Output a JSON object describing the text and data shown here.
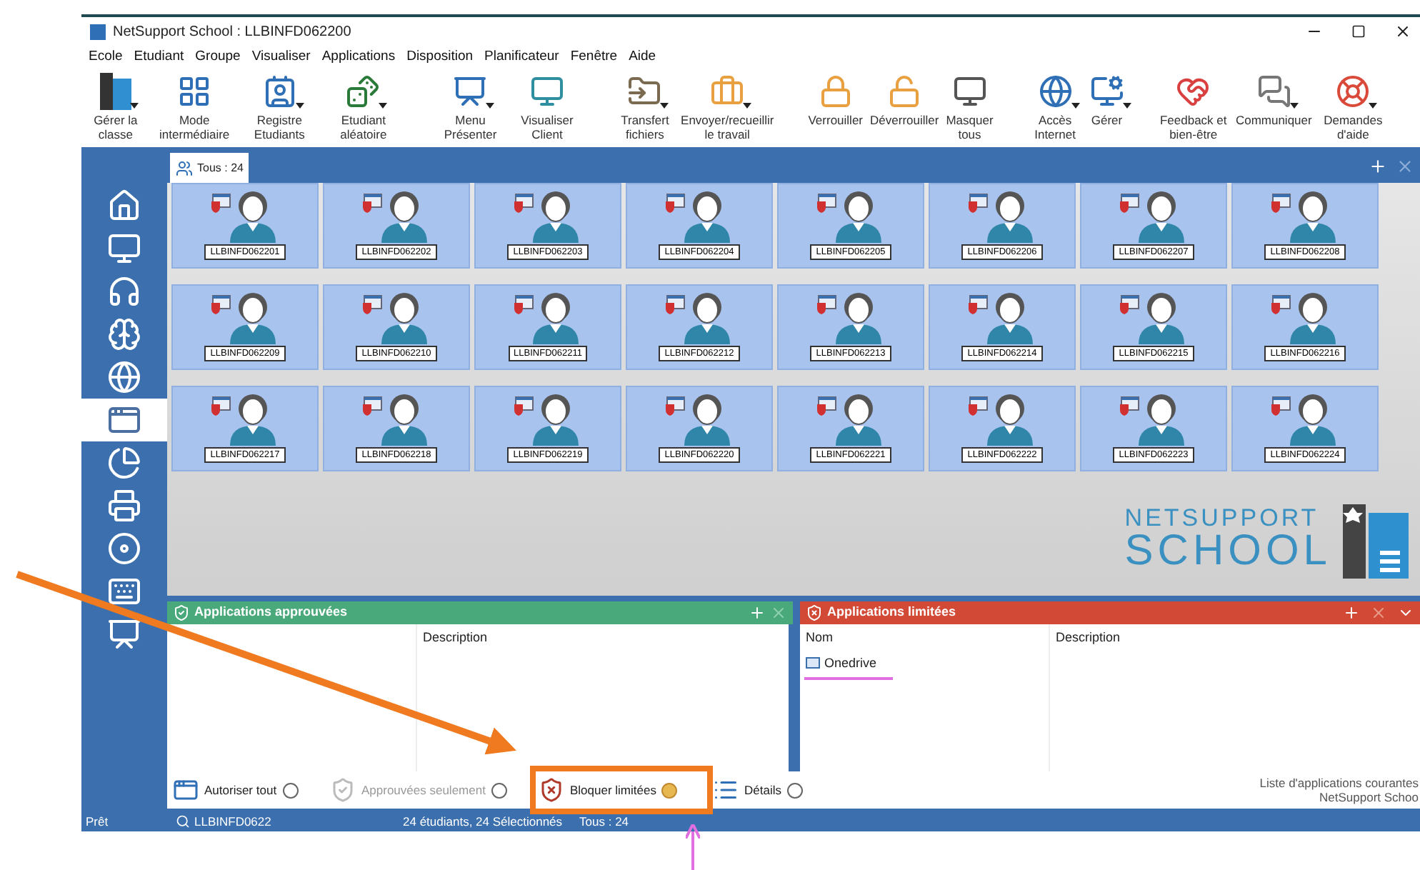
{
  "window": {
    "title": "NetSupport School : LLBINFD062200"
  },
  "menu": [
    "Ecole",
    "Etudiant",
    "Groupe",
    "Visualiser",
    "Applications",
    "Disposition",
    "Planificateur",
    "Fenêtre",
    "Aide"
  ],
  "toolbar": {
    "groups": [
      [
        {
          "label": "Gérer la classe",
          "dropdown": true
        },
        {
          "label": "Mode intermédiaire",
          "dropdown": false
        },
        {
          "label": "Registre Etudiants",
          "dropdown": true
        },
        {
          "label": "Etudiant aléatoire",
          "dropdown": true
        }
      ],
      [
        {
          "label": "Menu Présenter",
          "dropdown": true
        },
        {
          "label": "Visualiser Client",
          "dropdown": false
        }
      ],
      [
        {
          "label": "Transfert fichiers",
          "dropdown": true
        },
        {
          "label": "Envoyer/recueillir le travail",
          "dropdown": true
        }
      ],
      [
        {
          "label": "Verrouiller",
          "dropdown": false
        },
        {
          "label": "Déverrouiller",
          "dropdown": false
        },
        {
          "label": "Masquer tous",
          "dropdown": false
        }
      ],
      [
        {
          "label": "Accès Internet",
          "dropdown": true
        },
        {
          "label": "Gérer",
          "dropdown": true
        }
      ],
      [
        {
          "label": "Feedback et bien-être",
          "dropdown": false
        },
        {
          "label": "Communiquer",
          "dropdown": true
        },
        {
          "label": "Demandes d'aide",
          "dropdown": true
        }
      ]
    ]
  },
  "group_tab": {
    "label": "Tous : 24",
    "selected": true
  },
  "sidebar": {
    "items": [
      {
        "selected": false
      },
      {
        "selected": false
      },
      {
        "selected": false
      },
      {
        "selected": false
      },
      {
        "selected": false
      },
      {
        "selected": true
      },
      {
        "selected": false
      },
      {
        "selected": false
      },
      {
        "selected": false
      },
      {
        "selected": false
      },
      {
        "selected": false
      }
    ]
  },
  "students": [
    {
      "name": "LLBINFD062201",
      "selected": true
    },
    {
      "name": "LLBINFD062202",
      "selected": true
    },
    {
      "name": "LLBINFD062203",
      "selected": true
    },
    {
      "name": "LLBINFD062204",
      "selected": true
    },
    {
      "name": "LLBINFD062205",
      "selected": true
    },
    {
      "name": "LLBINFD062206",
      "selected": true
    },
    {
      "name": "LLBINFD062207",
      "selected": true
    },
    {
      "name": "LLBINFD062208",
      "selected": true
    },
    {
      "name": "LLBINFD062209",
      "selected": true
    },
    {
      "name": "LLBINFD062210",
      "selected": true
    },
    {
      "name": "LLBINFD062211",
      "selected": true
    },
    {
      "name": "LLBINFD062212",
      "selected": true
    },
    {
      "name": "LLBINFD062213",
      "selected": true
    },
    {
      "name": "LLBINFD062214",
      "selected": true
    },
    {
      "name": "LLBINFD062215",
      "selected": true
    },
    {
      "name": "LLBINFD062216",
      "selected": true
    },
    {
      "name": "LLBINFD062217",
      "selected": true
    },
    {
      "name": "LLBINFD062218",
      "selected": true
    },
    {
      "name": "LLBINFD062219",
      "selected": true
    },
    {
      "name": "LLBINFD062220",
      "selected": true
    },
    {
      "name": "LLBINFD062221",
      "selected": true
    },
    {
      "name": "LLBINFD062222",
      "selected": true
    },
    {
      "name": "LLBINFD062223",
      "selected": true
    },
    {
      "name": "LLBINFD062224",
      "selected": true
    }
  ],
  "approved_panel": {
    "title": "Applications approuvées",
    "columns": [
      "Description"
    ]
  },
  "limited_panel": {
    "title": "Applications limitées",
    "columns": [
      "Nom",
      "Description"
    ],
    "rows": [
      {
        "name": "Onedrive"
      }
    ]
  },
  "options": [
    {
      "label": "Autoriser tout",
      "selected": false,
      "disabled": false
    },
    {
      "label": "Approuvées seulement",
      "selected": false,
      "disabled": true
    },
    {
      "label": "Bloquer limitées",
      "selected": true,
      "disabled": false
    },
    {
      "label": "Détails",
      "selected": false,
      "disabled": false
    }
  ],
  "options_note": [
    "Liste d'applications courantes",
    "NetSupport Schoo"
  ],
  "logo": {
    "line1": "NETSUPPORT",
    "line2": "SCHOOL"
  },
  "status_bar": {
    "state": "Prêt",
    "computer": "LLBINFD0622",
    "summary": "24 étudiants, 24 Sélectionnés",
    "group": "Tous : 24"
  }
}
